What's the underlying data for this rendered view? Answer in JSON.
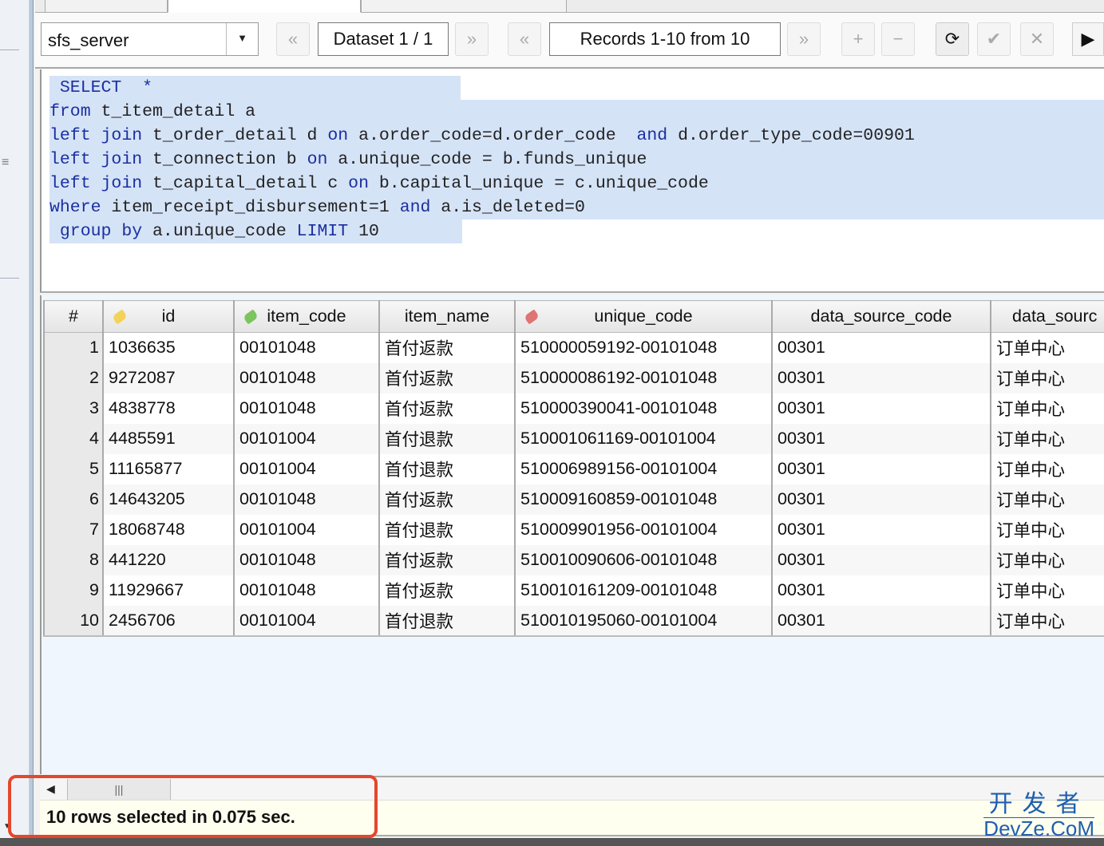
{
  "toolbar": {
    "connection": "sfs_server",
    "dataset_label": "Dataset 1 / 1",
    "records_label": "Records 1-10 from 10",
    "icons": {
      "dataset_prev": "«",
      "dataset_next": "»",
      "records_prev": "«",
      "records_next": "»",
      "add": "+",
      "remove": "−",
      "refresh": "⟳",
      "apply": "✔",
      "cancel": "✕",
      "more": "▶"
    }
  },
  "sql": {
    "lines": [
      {
        "parts": [
          {
            "t": " SELECT  *",
            "kw": true
          }
        ]
      },
      {
        "parts": [
          {
            "t": "from",
            "kw": true
          },
          {
            "t": " t_item_detail a",
            "kw": false
          }
        ]
      },
      {
        "parts": [
          {
            "t": "left join",
            "kw": true
          },
          {
            "t": " t_order_detail d ",
            "kw": false
          },
          {
            "t": "on",
            "kw": true
          },
          {
            "t": " a.order_code=d.order_code  ",
            "kw": false
          },
          {
            "t": "and",
            "kw": true
          },
          {
            "t": " d.order_type_code=00901",
            "kw": false
          }
        ]
      },
      {
        "parts": [
          {
            "t": "left join",
            "kw": true
          },
          {
            "t": " t_connection b ",
            "kw": false
          },
          {
            "t": "on",
            "kw": true
          },
          {
            "t": " a.unique_code = b.funds_unique",
            "kw": false
          }
        ]
      },
      {
        "parts": [
          {
            "t": "left join",
            "kw": true
          },
          {
            "t": " t_capital_detail c ",
            "kw": false
          },
          {
            "t": "on",
            "kw": true
          },
          {
            "t": " b.capital_unique = c.unique_code",
            "kw": false
          }
        ]
      },
      {
        "parts": [
          {
            "t": "where",
            "kw": true
          },
          {
            "t": " item_receipt_disbursement=1 ",
            "kw": false
          },
          {
            "t": "and",
            "kw": true
          },
          {
            "t": " a.is_deleted=0",
            "kw": false
          }
        ]
      },
      {
        "parts": [
          {
            "t": " group by",
            "kw": true
          },
          {
            "t": " a.unique_code ",
            "kw": false
          },
          {
            "t": "LIMIT",
            "kw": true
          },
          {
            "t": " 10",
            "kw": false
          }
        ]
      }
    ]
  },
  "grid": {
    "columns": [
      {
        "label": "#",
        "key_icon": null
      },
      {
        "label": "id",
        "key_icon": "gold"
      },
      {
        "label": "item_code",
        "key_icon": "green"
      },
      {
        "label": "item_name",
        "key_icon": null
      },
      {
        "label": "unique_code",
        "key_icon": "red"
      },
      {
        "label": "data_source_code",
        "key_icon": null
      },
      {
        "label": "data_sourc",
        "key_icon": null
      }
    ],
    "rows": [
      [
        "1",
        "1036635",
        "00101048",
        "首付返款",
        "510000059192-00101048",
        "00301",
        "订单中心"
      ],
      [
        "2",
        "9272087",
        "00101048",
        "首付返款",
        "510000086192-00101048",
        "00301",
        "订单中心"
      ],
      [
        "3",
        "4838778",
        "00101048",
        "首付返款",
        "510000390041-00101048",
        "00301",
        "订单中心"
      ],
      [
        "4",
        "4485591",
        "00101004",
        "首付退款",
        "510001061169-00101004",
        "00301",
        "订单中心"
      ],
      [
        "5",
        "11165877",
        "00101004",
        "首付退款",
        "510006989156-00101004",
        "00301",
        "订单中心"
      ],
      [
        "6",
        "14643205",
        "00101048",
        "首付返款",
        "510009160859-00101048",
        "00301",
        "订单中心"
      ],
      [
        "7",
        "18068748",
        "00101004",
        "首付退款",
        "510009901956-00101004",
        "00301",
        "订单中心"
      ],
      [
        "8",
        "441220",
        "00101048",
        "首付返款",
        "510010090606-00101048",
        "00301",
        "订单中心"
      ],
      [
        "9",
        "11929667",
        "00101048",
        "首付返款",
        "510010161209-00101048",
        "00301",
        "订单中心"
      ],
      [
        "10",
        "2456706",
        "00101004",
        "首付退款",
        "510010195060-00101004",
        "00301",
        "订单中心"
      ]
    ]
  },
  "status": {
    "message": "10 rows selected in 0.075 sec."
  },
  "scrollbar": {
    "thumb_glyph": "|||",
    "left_arrow": "◀"
  },
  "sidebar": {
    "menu_glyph": "≡",
    "down_glyph": "▼"
  },
  "watermark": {
    "cn": "开发者",
    "en": "DevZe.CoM"
  },
  "colors": {
    "keyword": "#1a2fa0",
    "selection": "#d5e3f7",
    "highlight_box": "#e6462c",
    "status_bg": "#fffff0",
    "watermark": "#1f5fae"
  }
}
